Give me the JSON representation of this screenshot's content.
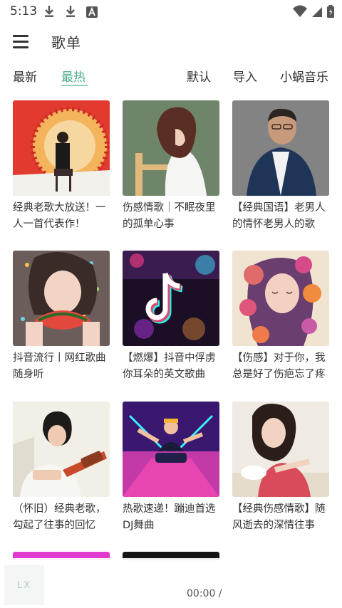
{
  "status_bar": {
    "time": "5:13",
    "left_icons": [
      "download-icon",
      "download-icon",
      "app-a-icon"
    ],
    "right_icons": [
      "wifi-icon",
      "signal-icon",
      "battery-icon"
    ]
  },
  "header": {
    "menu_icon": "menu-icon",
    "title": "歌单"
  },
  "tabs": {
    "newest": "最新",
    "hot": "最热",
    "active": "最热",
    "active_color": "#4aa98b"
  },
  "toolbar": {
    "default_label": "默认",
    "import_label": "导入",
    "source_label": "小蜗音乐"
  },
  "playlists": [
    {
      "title_line1": "经典老歌大放送！一",
      "title_line2": "人一首代表作！"
    },
    {
      "title_line1": "伤感情歌｜不眠夜里",
      "title_line2": "的孤单心事"
    },
    {
      "title_line1": "【经典国语】老男人",
      "title_line2": "的情怀老男人的歌"
    },
    {
      "title_line1": "抖音流行丨网红歌曲",
      "title_line2": "随身听"
    },
    {
      "title_line1": "【燃爆】抖音中俘虏",
      "title_line2": "你耳朵的英文歌曲"
    },
    {
      "title_line1": "【伤感】对于你，我",
      "title_line2": "总是好了伤疤忘了疼"
    },
    {
      "title_line1": "（怀旧）经典老歌，",
      "title_line2": "勾起了往事的回忆"
    },
    {
      "title_line1": "热歌速递！蹦迪首选",
      "title_line2": "DJ舞曲"
    },
    {
      "title_line1": "【经典伤感情歌】随",
      "title_line2": "风逝去的深情往事"
    }
  ],
  "player": {
    "art_text": "LX",
    "time": "00:00 /"
  }
}
